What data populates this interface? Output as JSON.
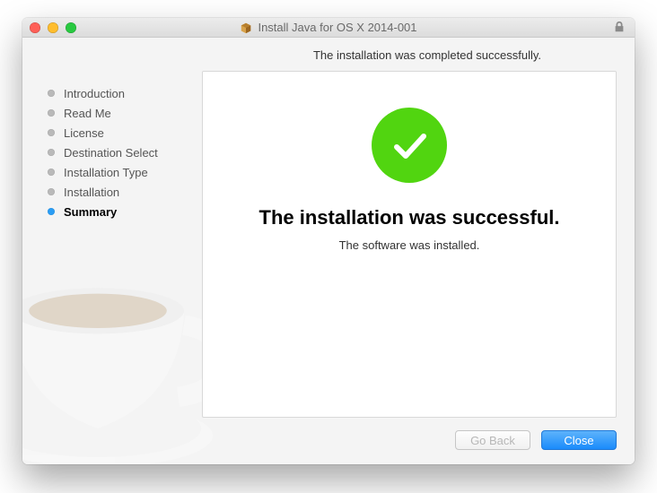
{
  "window": {
    "title": "Install Java for OS X 2014-001"
  },
  "subtitle": "The installation was completed successfully.",
  "sidebar": {
    "items": [
      {
        "label": "Introduction",
        "active": false
      },
      {
        "label": "Read Me",
        "active": false
      },
      {
        "label": "License",
        "active": false
      },
      {
        "label": "Destination Select",
        "active": false
      },
      {
        "label": "Installation Type",
        "active": false
      },
      {
        "label": "Installation",
        "active": false
      },
      {
        "label": "Summary",
        "active": true
      }
    ]
  },
  "panel": {
    "title": "The installation was successful.",
    "subtext": "The software was installed."
  },
  "footer": {
    "back_label": "Go Back",
    "close_label": "Close"
  }
}
